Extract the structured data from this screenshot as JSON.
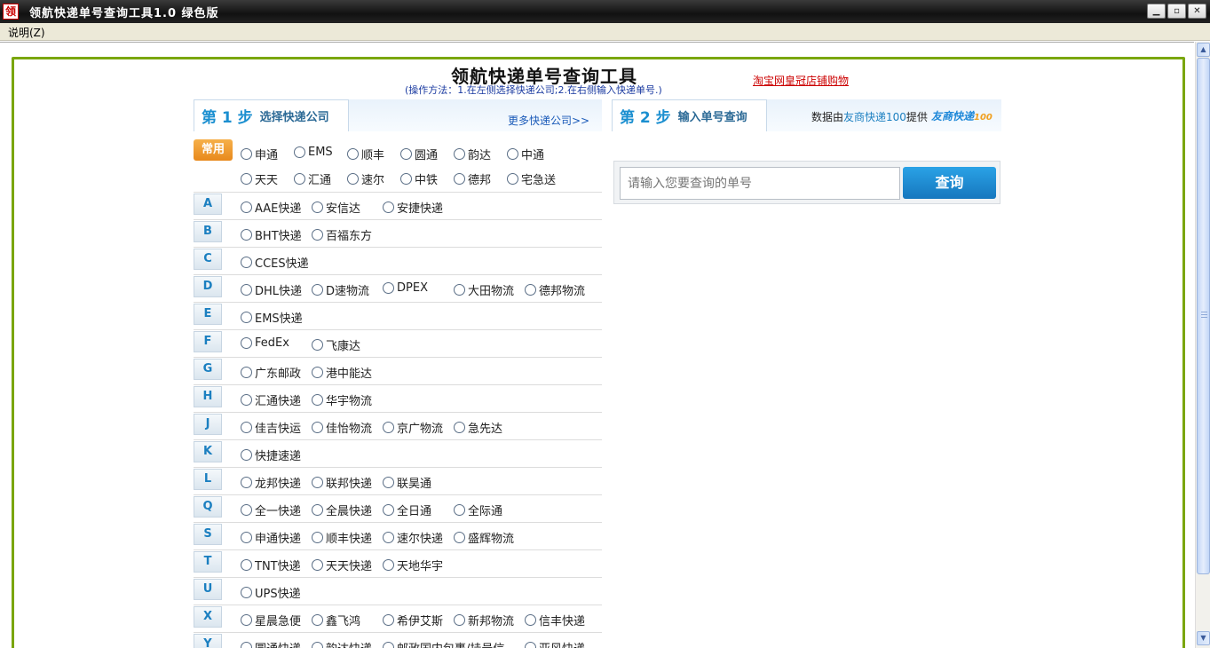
{
  "window": {
    "icon_char": "领",
    "title": "领航快递单号查询工具1.0 绿色版",
    "minimize": "▁",
    "maximize": "▫",
    "close": "✕"
  },
  "menu": {
    "help_label": "说明(Z)"
  },
  "header": {
    "title": "领航快递单号查询工具",
    "instructions": "(操作方法：1.在左侧选择快递公司;2.在右侧输入快递单号.)",
    "taobao_link": "淘宝网皇冠店铺购物"
  },
  "step1": {
    "num": "第 1 步",
    "name": "选择快递公司",
    "more_link": "更多快递公司>>"
  },
  "step2": {
    "num": "第 2 步",
    "name": "输入单号查询",
    "credit_prefix": "数据由",
    "credit_link": "友商快递100",
    "credit_suffix": "提供",
    "credit_logo": "友商快递",
    "credit_logo_sub": "100",
    "search_placeholder": "请输入您要查询的单号",
    "search_button": "查询"
  },
  "common": {
    "badge": "常用",
    "row1": [
      "申通",
      "EMS",
      "顺丰",
      "圆通",
      "韵达",
      "中通"
    ],
    "row2": [
      "天天",
      "汇通",
      "速尔",
      "中铁",
      "德邦",
      "宅急送"
    ]
  },
  "groups": [
    {
      "letter": "A",
      "items": [
        "AAE快递",
        "安信达",
        "安捷快递"
      ]
    },
    {
      "letter": "B",
      "items": [
        "BHT快递",
        "百福东方"
      ]
    },
    {
      "letter": "C",
      "items": [
        "CCES快递"
      ]
    },
    {
      "letter": "D",
      "items": [
        "DHL快递",
        "D速物流",
        "DPEX",
        "大田物流",
        "德邦物流"
      ]
    },
    {
      "letter": "E",
      "items": [
        "EMS快递"
      ]
    },
    {
      "letter": "F",
      "items": [
        "FedEx",
        "飞康达"
      ]
    },
    {
      "letter": "G",
      "items": [
        "广东邮政",
        "港中能达"
      ]
    },
    {
      "letter": "H",
      "items": [
        "汇通快递",
        "华宇物流"
      ]
    },
    {
      "letter": "J",
      "items": [
        "佳吉快运",
        "佳怡物流",
        "京广物流",
        "急先达"
      ]
    },
    {
      "letter": "K",
      "items": [
        "快捷速递"
      ]
    },
    {
      "letter": "L",
      "items": [
        "龙邦快递",
        "联邦快递",
        "联昊通"
      ]
    },
    {
      "letter": "Q",
      "items": [
        "全一快递",
        "全晨快递",
        "全日通",
        "全际通"
      ]
    },
    {
      "letter": "S",
      "items": [
        "申通快递",
        "顺丰快递",
        "速尔快递",
        "盛辉物流"
      ]
    },
    {
      "letter": "T",
      "items": [
        "TNT快递",
        "天天快递",
        "天地华宇"
      ]
    },
    {
      "letter": "U",
      "items": [
        "UPS快递"
      ]
    },
    {
      "letter": "X",
      "items": [
        "星晨急便",
        "鑫飞鸿",
        "希伊艾斯",
        "新邦物流",
        "信丰快递"
      ]
    },
    {
      "letter": "Y",
      "items": [
        "圆通快递",
        "韵达快递",
        "邮政国内包裹/挂号信",
        "亚风快递"
      ]
    }
  ]
}
